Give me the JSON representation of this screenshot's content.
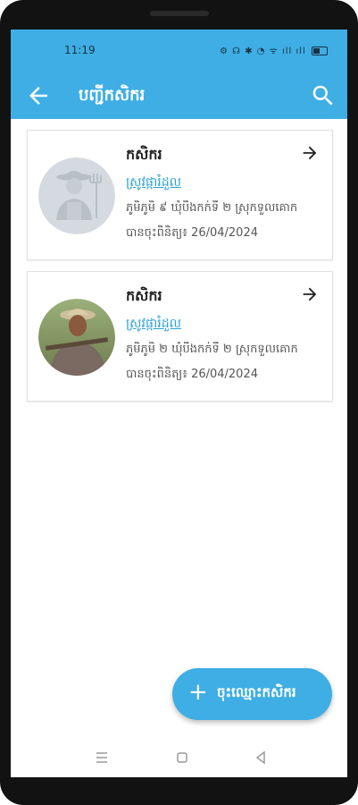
{
  "status_bar": {
    "time": "11:19",
    "icons": "⚙ ☊ ✱ ◔ ᯤ ıll ıll"
  },
  "app_bar": {
    "title": "បញ្ជីកសិករ"
  },
  "farmers": [
    {
      "name": "កសិករ",
      "source": "ស្រូវផ្ការំដួល",
      "address": "ភូមិភូមិ ៩ ឃុំបឹងកក់ទី ២ ស្រុកទួលគោក",
      "date": "បានចុះពិនិត្យ៖ 26/04/2024",
      "avatar": "placeholder"
    },
    {
      "name": "កសិករ",
      "source": "ស្រូវផ្ការំដួល",
      "address": "ភូមិភូមិ ២ ឃុំបឹងកក់ទី ២ ស្រុកទួលគោក",
      "date": "បានចុះពិនិត្យ៖ 26/04/2024",
      "avatar": "photo"
    }
  ],
  "fab": {
    "icon": "+",
    "label": "ចុះឈ្មោះកសិករ"
  },
  "colors": {
    "primary": "#3eaee4",
    "link": "#2b9fd6"
  }
}
